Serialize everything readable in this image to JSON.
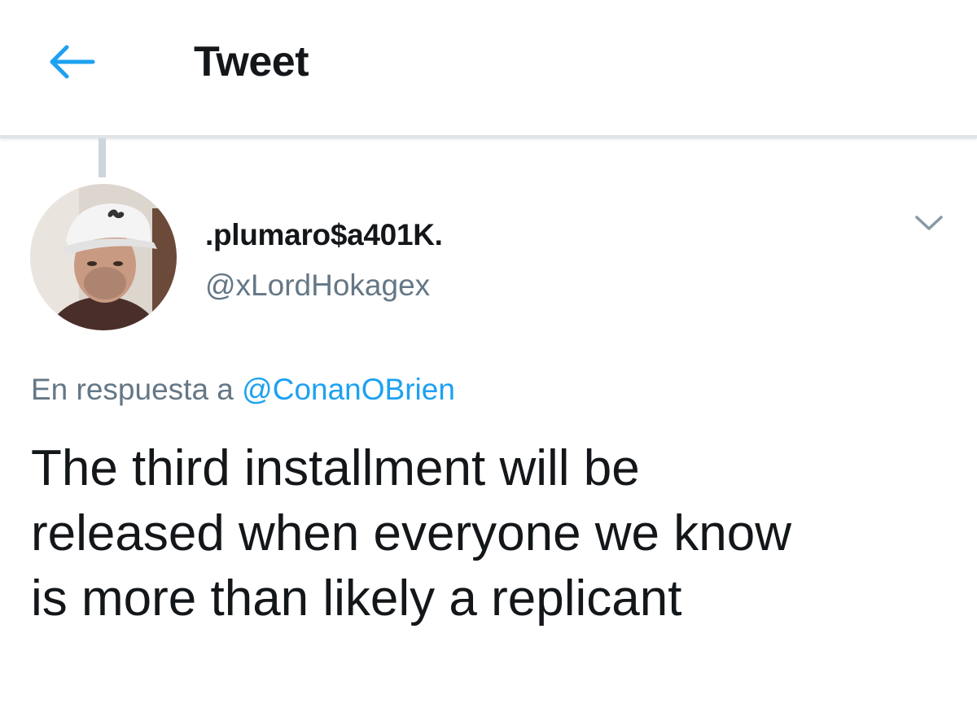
{
  "header": {
    "title": "Tweet",
    "back_icon": "arrow-left-icon",
    "accent_color": "#1da1f2"
  },
  "tweet": {
    "author": {
      "display_name": ".plumaro$a401K.",
      "handle": "@xLordHokagex",
      "avatar_icon": "user-avatar"
    },
    "menu_icon": "chevron-down-icon",
    "reply_prefix": "En respuesta a",
    "reply_mention": "@ConanOBrien",
    "text_lines": [
      "The third installment will be",
      "released when everyone we know",
      "is more than likely a replicant"
    ]
  }
}
